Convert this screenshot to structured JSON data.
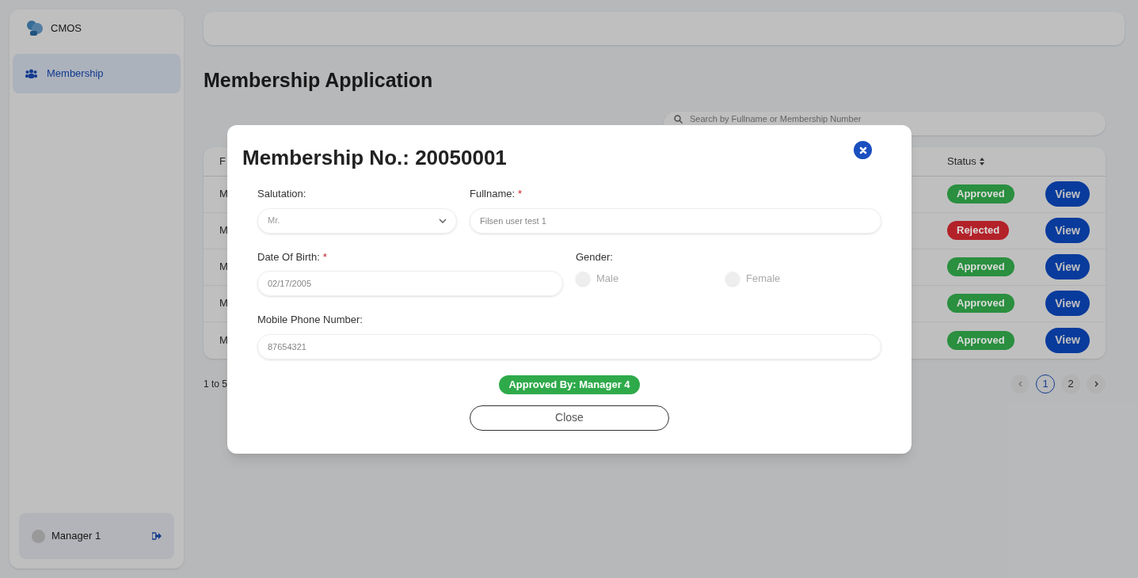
{
  "sidebar": {
    "brand": "CMOS",
    "items": [
      {
        "label": "Membership",
        "selected": true
      }
    ],
    "user": {
      "name": "Manager 1"
    }
  },
  "page": {
    "title": "Membership Application",
    "search": {
      "placeholder": "Search by Fullname or Membership Number"
    },
    "table": {
      "columns": [
        "F",
        "Status"
      ],
      "rows": [
        {
          "column_1": "M",
          "status": "Approved",
          "color": "#2a8f3f",
          "action": "View"
        },
        {
          "column_1": "M",
          "status": "Rejected",
          "color": "#b32229",
          "action": "View"
        },
        {
          "column_1": "M",
          "status": "Approved",
          "color": "#2a8f3f",
          "action": "View"
        },
        {
          "column_1": "M",
          "status": "Approved",
          "color": "#2a8f3f",
          "action": "View"
        },
        {
          "column_1": "M",
          "status": "Approved",
          "color": "#2a8f3f",
          "action": "View"
        }
      ]
    },
    "footer": "1 to 5",
    "pages": [
      {
        "label": "1",
        "selected": true
      },
      {
        "label": "2",
        "selected": false
      }
    ]
  },
  "modal": {
    "title": "Membership No.: 20050001",
    "salutation": {
      "label": "Salutation:",
      "value": "Mr."
    },
    "fullname": {
      "label": "Fullname:",
      "required_mark": "*",
      "placeholder": "Filsen user test 1"
    },
    "dob": {
      "label": "Date Of Birth:",
      "required_mark": "*",
      "placeholder": "02/17/2005"
    },
    "gender": {
      "label": "Gender:",
      "options": [
        {
          "label": "Male",
          "selected": false
        },
        {
          "label": "Female",
          "selected": false
        }
      ]
    },
    "phone": {
      "label": "Mobile Phone Number:",
      "placeholder": "87654321"
    },
    "approved_by": "Approved By: Manager 4",
    "close": "Close"
  }
}
